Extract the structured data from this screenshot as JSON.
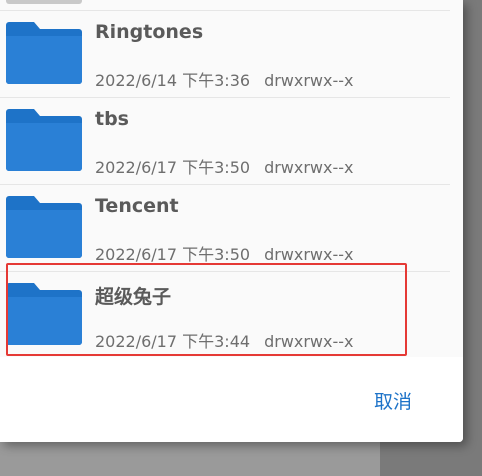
{
  "files": [
    {
      "name": "Ringtones",
      "date": "2022/6/14 下午3:36",
      "permissions": "drwxrwx--x"
    },
    {
      "name": "tbs",
      "date": "2022/6/17 下午3:50",
      "permissions": "drwxrwx--x"
    },
    {
      "name": "Tencent",
      "date": "2022/6/17 下午3:50",
      "permissions": "drwxrwx--x"
    },
    {
      "name": "超级兔子",
      "date": "2022/6/17 下午3:44",
      "permissions": "drwxrwx--x"
    }
  ],
  "footer": {
    "cancel_label": "取消"
  },
  "colors": {
    "folder": "#1e73c8",
    "accent": "#1e73c8",
    "highlight": "#e53935"
  },
  "icons": {
    "folder": "folder-icon"
  }
}
